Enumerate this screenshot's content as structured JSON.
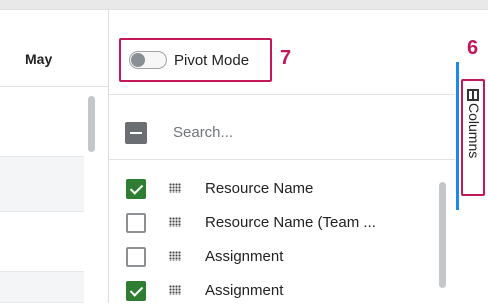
{
  "grid": {
    "column_header": "May"
  },
  "panel": {
    "pivot_mode_label": "Pivot Mode",
    "search_placeholder": "Search...",
    "columns": [
      {
        "label": "Resource Name",
        "checked": true
      },
      {
        "label": "Resource Name (Team ...",
        "checked": false
      },
      {
        "label": "Assignment",
        "checked": false
      },
      {
        "label": "Assignment",
        "checked": true
      }
    ]
  },
  "side_tab": {
    "label": "Columns",
    "icon": "columns-icon"
  },
  "callouts": {
    "pivot": "7",
    "columns_tab": "6"
  },
  "colors": {
    "callout": "#c2185b",
    "checked": "#2e7d32",
    "accent": "#1e88e5"
  }
}
